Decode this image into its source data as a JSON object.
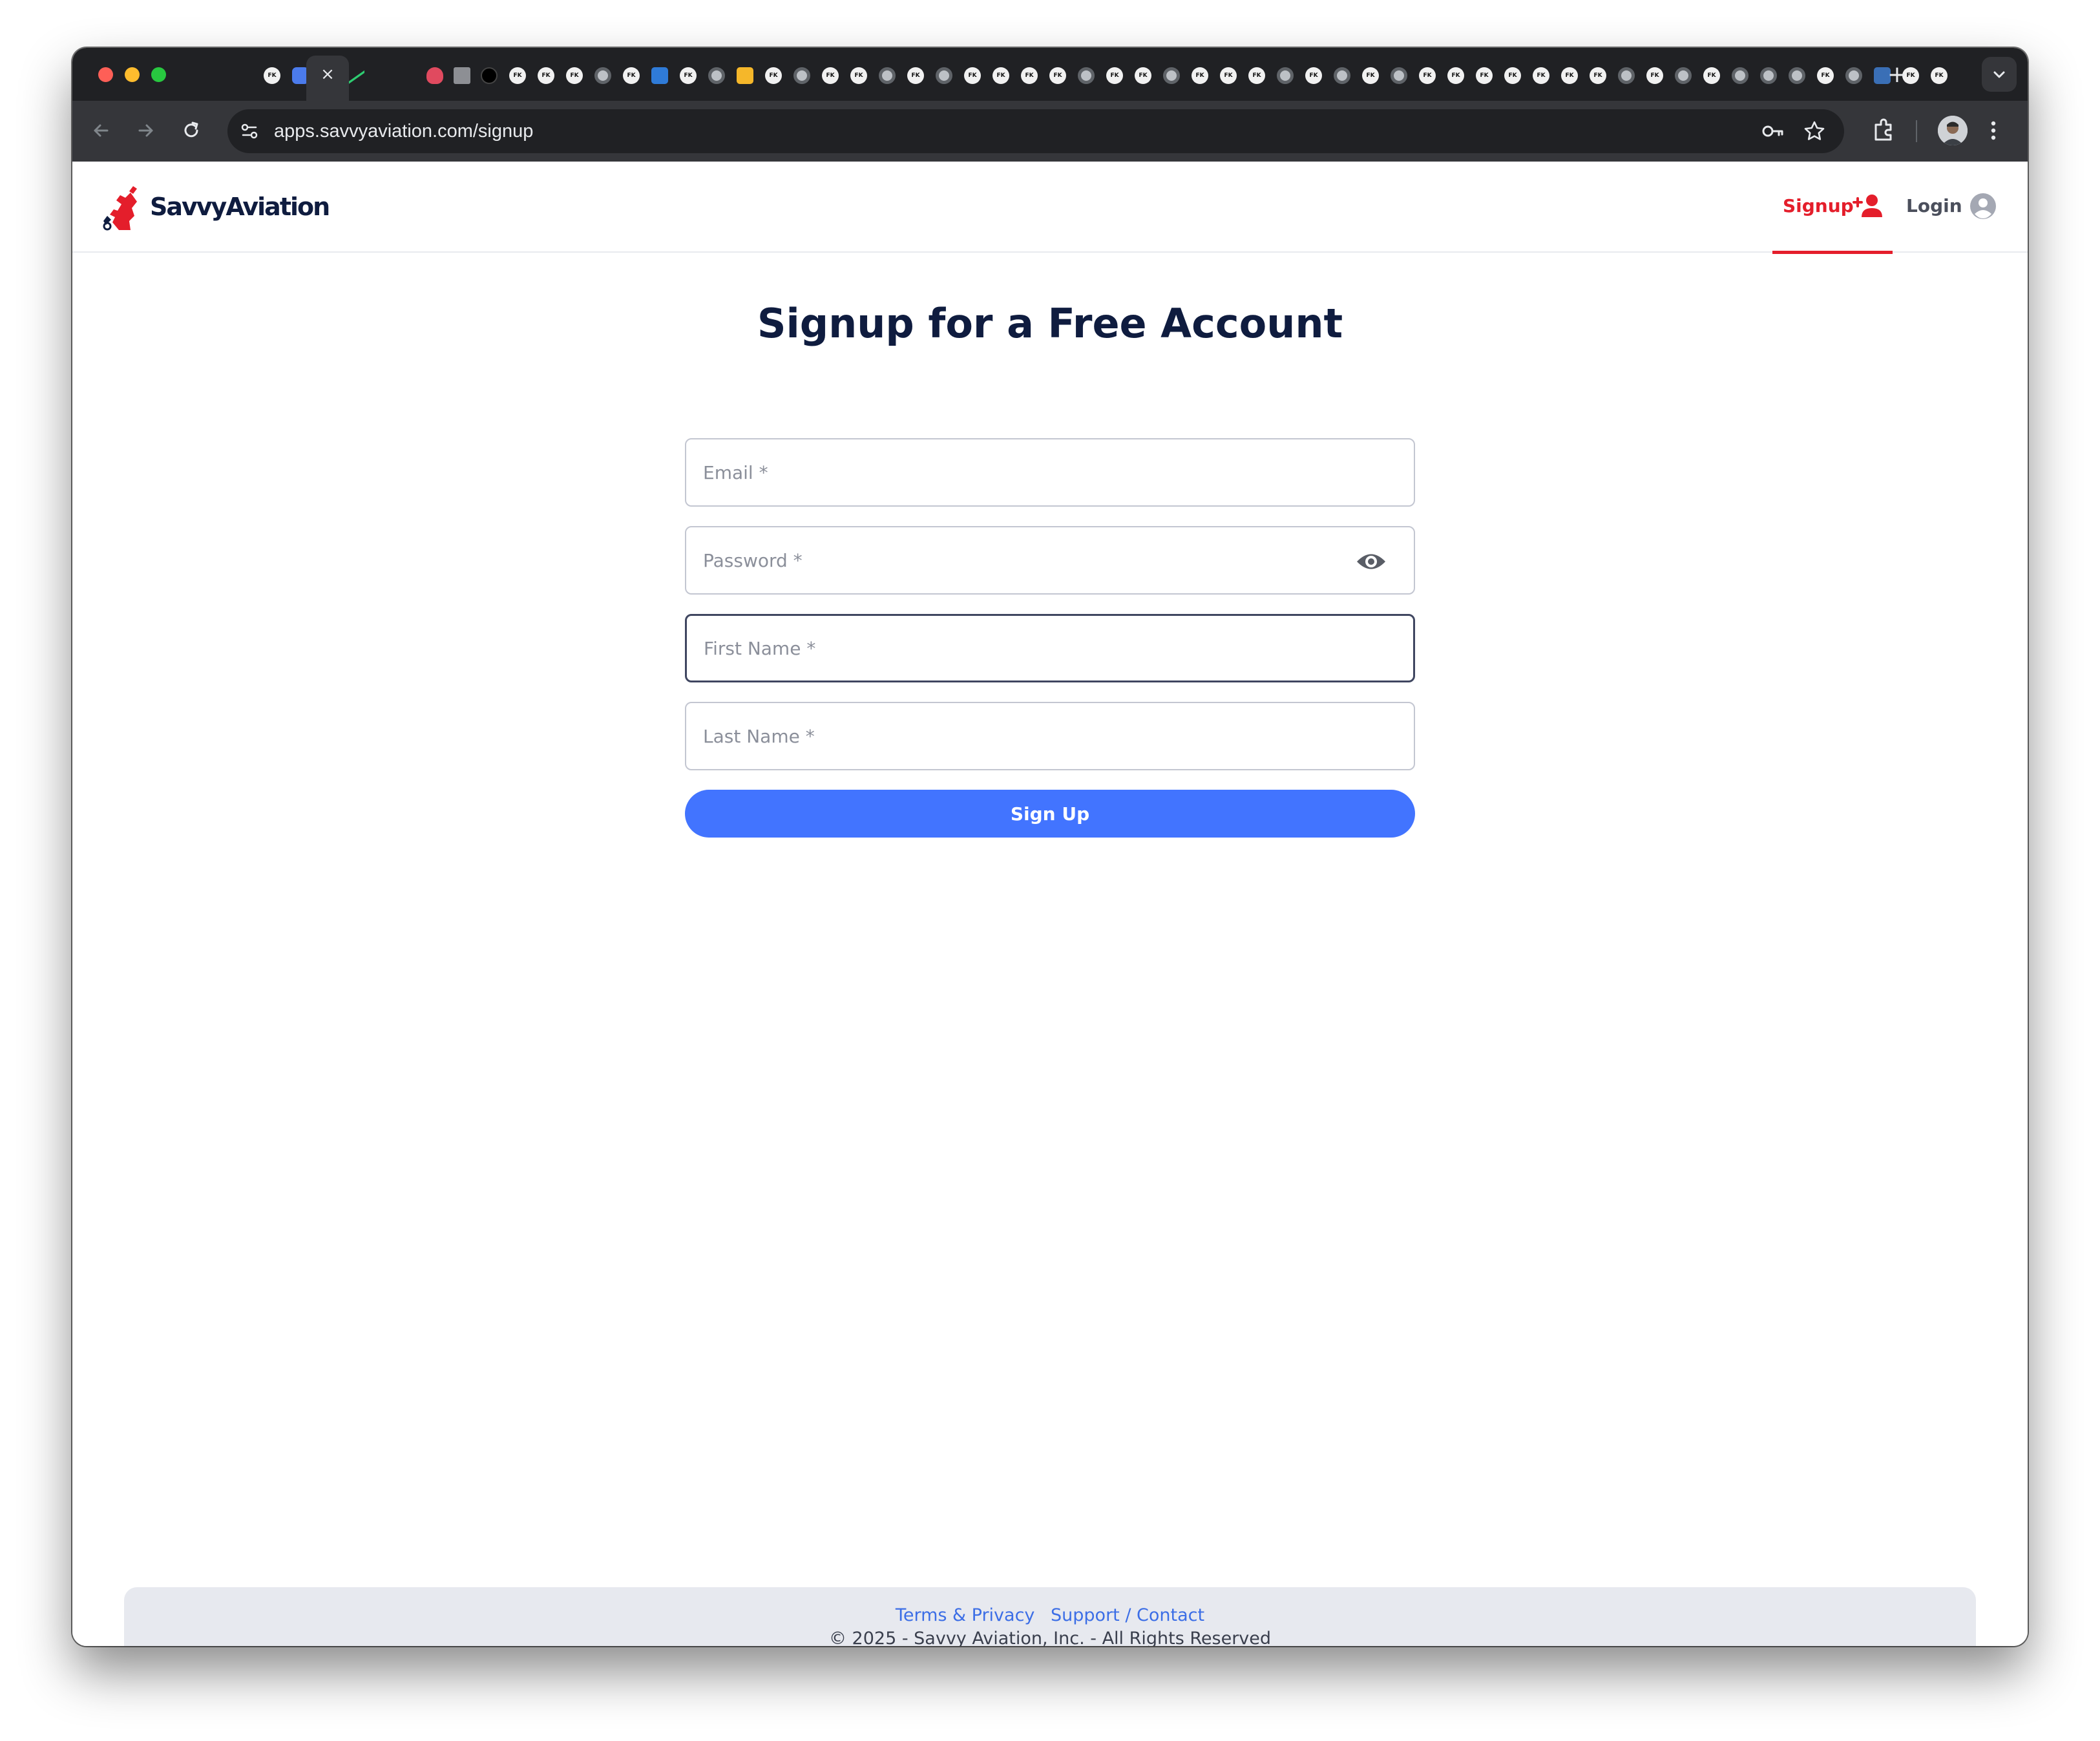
{
  "browser": {
    "url": "apps.savvyaviation.com/signup",
    "tab_close_glyph": "×",
    "new_tab_glyph": "+",
    "tab_icon_text": "FK"
  },
  "header": {
    "logo_text": "SavvyAviation",
    "nav": {
      "signup_label": "Signup",
      "login_label": "Login"
    }
  },
  "form": {
    "title": "Signup for a Free Account",
    "email_placeholder": "Email *",
    "password_placeholder": "Password *",
    "first_name_placeholder": "First Name *",
    "last_name_placeholder": "Last Name *",
    "submit_label": "Sign Up"
  },
  "footer": {
    "terms_label": "Terms & Privacy",
    "support_label": "Support / Contact",
    "copyright": "© 2025 - Savvy Aviation, Inc. - All Rights Reserved"
  },
  "colors": {
    "brand_red": "#e41e2b",
    "brand_navy": "#0f1c3f",
    "button_blue": "#4274ff",
    "link_blue": "#3c6ee6"
  }
}
